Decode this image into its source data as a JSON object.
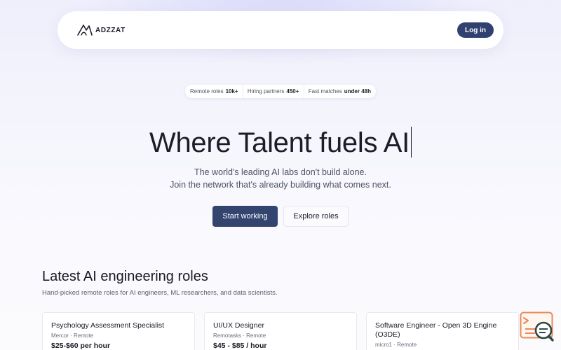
{
  "nav": {
    "brand_name": "ADZZAT",
    "login_label": "Log in"
  },
  "stats": [
    {
      "label": "Remote roles",
      "value": "10k+"
    },
    {
      "label": "Hiring partners",
      "value": "450+"
    },
    {
      "label": "Fast matches",
      "value": "under 48h"
    }
  ],
  "hero": {
    "title": "Where Talent fuels AI",
    "subtitle_line1": "The world's leading AI labs don't build alone.",
    "subtitle_line2": "Join the network that's already building what comes next.",
    "primary_cta": "Start working",
    "secondary_cta": "Explore roles"
  },
  "roles_section": {
    "title": "Latest AI engineering roles",
    "subtitle": "Hand-picked remote roles for AI engineers, ML researchers, and data scientists.",
    "cards": [
      {
        "title": "Psychology Assessment Specialist",
        "company": "Mercor",
        "location": "Remote",
        "pay": "$25-$60 per hour"
      },
      {
        "title": "UI/UX Designer",
        "company": "Remotasks",
        "location": "Remote",
        "pay": "$45 - $85 / hour"
      },
      {
        "title": "Software Engineer - Open 3D Engine (O3DE)",
        "company": "micro1",
        "location": "Remote",
        "pay": ""
      }
    ]
  },
  "widget": {
    "icon": "chat-search-icon",
    "accent": "#e8885a",
    "icon_color": "#2d4a45"
  },
  "colors": {
    "primary": "#33446f",
    "background": "#f6f6fd"
  }
}
